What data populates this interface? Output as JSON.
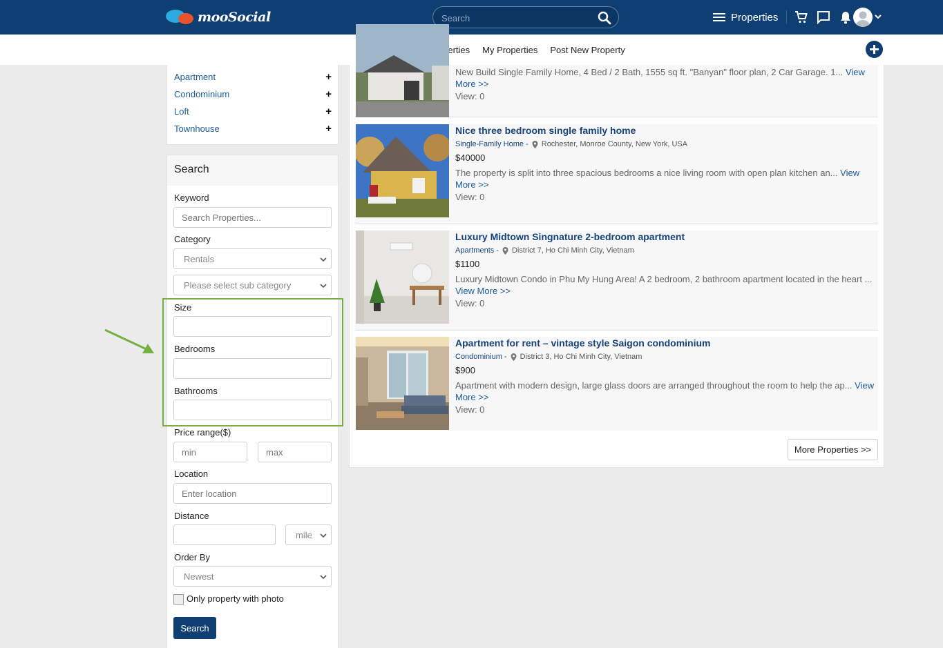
{
  "header": {
    "logo_text": "mooSocial",
    "search_placeholder": "Search",
    "properties_label": "Properties"
  },
  "subnav": {
    "links": [
      "Find Properties",
      "My Properties",
      "Post New Property"
    ]
  },
  "categories": {
    "items": [
      {
        "label": "Apartment",
        "toggle": "+"
      },
      {
        "label": "Condominium",
        "toggle": "+"
      },
      {
        "label": "Loft",
        "toggle": "+"
      },
      {
        "label": "Townhouse",
        "toggle": "+"
      }
    ]
  },
  "search": {
    "title": "Search",
    "keyword_label": "Keyword",
    "keyword_placeholder": "Search Properties...",
    "category_label": "Category",
    "category_value": "Rentals",
    "subcategory_value": "Please select sub category",
    "size_label": "Size",
    "bedrooms_label": "Bedrooms",
    "bathrooms_label": "Bathrooms",
    "price_label": "Price range($)",
    "min_placeholder": "min",
    "max_placeholder": "max",
    "location_label": "Location",
    "location_placeholder": "Enter location",
    "distance_label": "Distance",
    "distance_unit": "mile",
    "order_label": "Order By",
    "order_value": "Newest",
    "photo_label": "Only property with photo",
    "button_label": "Search"
  },
  "listings": [
    {
      "title": "",
      "category": "",
      "location": "",
      "price": "",
      "desc": "New Build Single Family Home, 4 Bed / 2 Bath, 1555 sq ft. \"Banyan\" floor plan, 2 Car Garage. 1...",
      "more": "View More >>",
      "views": "View: 0"
    },
    {
      "title": "Nice three bedroom single family home",
      "category": "Single-Family Home -",
      "location": "Rochester, Monroe County, New York, USA",
      "price": "$40000",
      "desc": "The property is split into three spacious bedrooms a nice living room with open plan kitchen an...",
      "more": "View More >>",
      "views": "View: 0"
    },
    {
      "title": "Luxury Midtown Singnature 2-bedroom apartment",
      "category": "Apartments -",
      "location": "District 7, Ho Chi Minh City, Vietnam",
      "price": "$1100",
      "desc": "Luxury Midtown Condo in Phu My Hung Area! A 2 bedroom, 2 bathroom apartment located in the heart ...",
      "more": "View More >>",
      "views": "View: 0"
    },
    {
      "title": "Apartment for rent – vintage style Saigon condominium",
      "category": "Condominium -",
      "location": "District 3, Ho Chi Minh City, Vietnam",
      "price": "$900",
      "desc": "Apartment with modern design, large glass doors are arranged throughout the room to help the ap...",
      "more": "View More >>",
      "views": "View: 0"
    }
  ],
  "more_button": "More Properties >>",
  "colors": {
    "brand": "#0f3f72",
    "link": "#1b5b9a",
    "highlight": "#76b043"
  }
}
